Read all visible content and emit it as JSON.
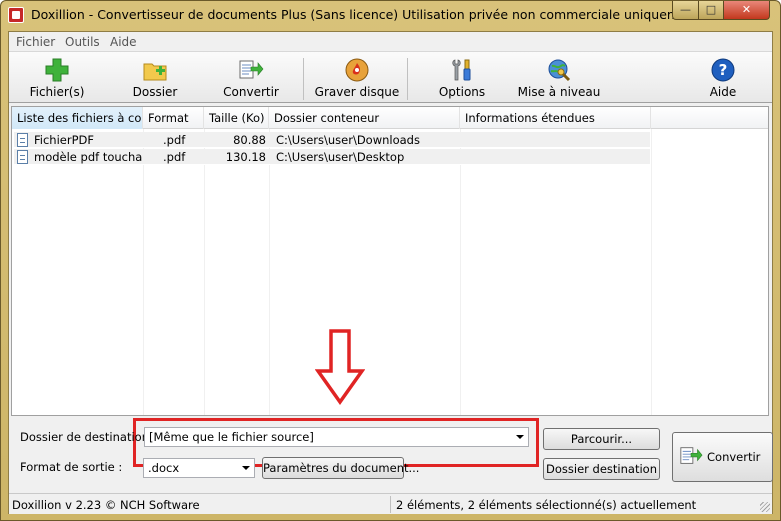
{
  "window": {
    "title": "Doxillion - Convertisseur de documents  Plus (Sans licence) Utilisation privée non commerciale uniquement",
    "min_glyph": "—",
    "max_glyph": "□",
    "close_glyph": "✕"
  },
  "menu": [
    "Fichier",
    "Outils",
    "Aide"
  ],
  "toolbar": {
    "files": "Fichier(s)",
    "folder": "Dossier",
    "convert": "Convertir",
    "burn": "Graver disque",
    "options": "Options",
    "update": "Mise à niveau",
    "help": "Aide"
  },
  "list": {
    "columns": [
      "Liste des fichiers à co...",
      "Format",
      "Taille (Ko)",
      "Dossier conteneur",
      "Informations étendues"
    ],
    "rows": [
      {
        "name": "FichierPDF",
        "format": ".pdf",
        "size": "80.88",
        "folder": "C:\\Users\\user\\Downloads",
        "info": ""
      },
      {
        "name": "modèle pdf touchar...",
        "format": ".pdf",
        "size": "130.18",
        "folder": "C:\\Users\\user\\Desktop",
        "info": ""
      }
    ]
  },
  "destination": {
    "label": "Dossier de destination :",
    "value": "[Même que le fichier source]",
    "browse": "Parcourir...",
    "open_folder": "Dossier destination"
  },
  "output": {
    "label": "Format de sortie :",
    "value": ".docx",
    "doc_params": "Paramètres du document..."
  },
  "convert_button": "Convertir",
  "status": {
    "left": "Doxillion v 2.23 © NCH Software",
    "right": "2 éléments, 2 éléments sélectionné(s) actuellement"
  },
  "colors": {
    "highlight": "#e02424",
    "title_bar": "#d9c27a"
  }
}
